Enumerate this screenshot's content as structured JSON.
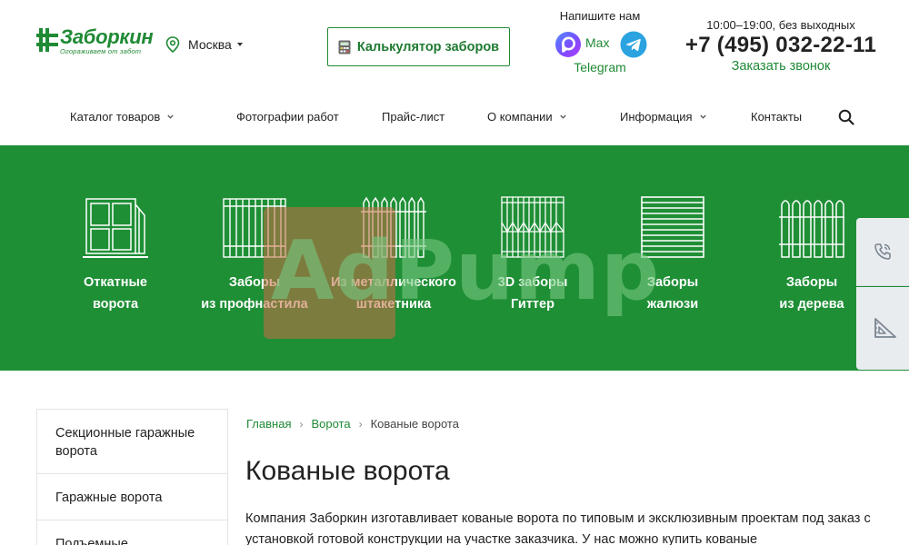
{
  "header": {
    "logo_name": "Заборкин",
    "logo_slogan": "Огораживаем от забот",
    "city": "Москва",
    "calc_button": "Калькулятор заборов",
    "messengers_title": "Напишите нам",
    "max_label": "Max",
    "telegram_label": "Telegram",
    "hours": "10:00–19:00, без выходных",
    "phone": "+7 (495) 032-22-11",
    "callback": "Заказать звонок"
  },
  "nav": {
    "items": [
      {
        "label": "Каталог товаров",
        "dropdown": true
      },
      {
        "label": "Фотографии работ",
        "dropdown": false
      },
      {
        "label": "Прайс-лист",
        "dropdown": false
      },
      {
        "label": "О компании",
        "dropdown": true
      },
      {
        "label": "Информация",
        "dropdown": true
      },
      {
        "label": "Контакты",
        "dropdown": false
      }
    ]
  },
  "categories": [
    {
      "line1": "Откатные",
      "line2": "ворота",
      "icon": "sliding-gate-icon"
    },
    {
      "line1": "Заборы",
      "line2": "из профнастила",
      "icon": "profiled-sheet-fence-icon"
    },
    {
      "line1": "Из металлического",
      "line2": "штакетника",
      "icon": "metal-picket-fence-icon"
    },
    {
      "line1": "3D заборы",
      "line2": "Гиттер",
      "icon": "3d-mesh-fence-icon"
    },
    {
      "line1": "Заборы",
      "line2": "жалюзи",
      "icon": "louver-fence-icon"
    },
    {
      "line1": "Заборы",
      "line2": "из дерева",
      "icon": "wooden-fence-icon"
    }
  ],
  "watermark": "AdPump",
  "sidebar": {
    "items": [
      "Секционные гаражные ворота",
      "Гаражные ворота",
      "Подъемные"
    ]
  },
  "breadcrumb": {
    "home": "Главная",
    "parent": "Ворота",
    "current": "Кованые ворота"
  },
  "page": {
    "title": "Кованые ворота",
    "intro": "Компания Заборкин изготавливает кованые ворота по типовым и эксклюзивным проектам под заказ с установкой готовой конструкции на участке заказчика. У нас можно купить кованые"
  },
  "colors": {
    "brand_green": "#1f8a34",
    "banner_green": "#1f8f36",
    "side_widget_bg": "#e9ecef"
  }
}
